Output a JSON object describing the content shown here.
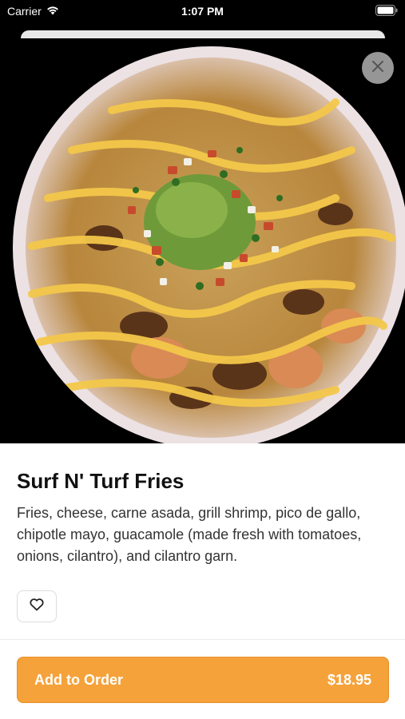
{
  "status_bar": {
    "carrier": "Carrier",
    "time": "1:07 PM",
    "icons": [
      "wifi-icon",
      "battery-icon"
    ]
  },
  "hero": {
    "image_subject": "loaded fries with carne asada, shrimp, pico de gallo, guacamole and chipotle mayo",
    "close_icon": "close-icon"
  },
  "item": {
    "title": "Surf N' Turf Fries",
    "description": "Fries, cheese, carne asada, grill shrimp, pico de gallo, chipotle mayo, guacamole (made fresh with tomatoes, onions, cilantro), and cilantro garn.",
    "favorite_icon": "heart-icon"
  },
  "order": {
    "add_label": "Add to Order",
    "price": "$18.95"
  },
  "colors": {
    "accent": "#f5a23a",
    "accent_border": "#e69028",
    "title": "#111111",
    "text": "#333333"
  }
}
